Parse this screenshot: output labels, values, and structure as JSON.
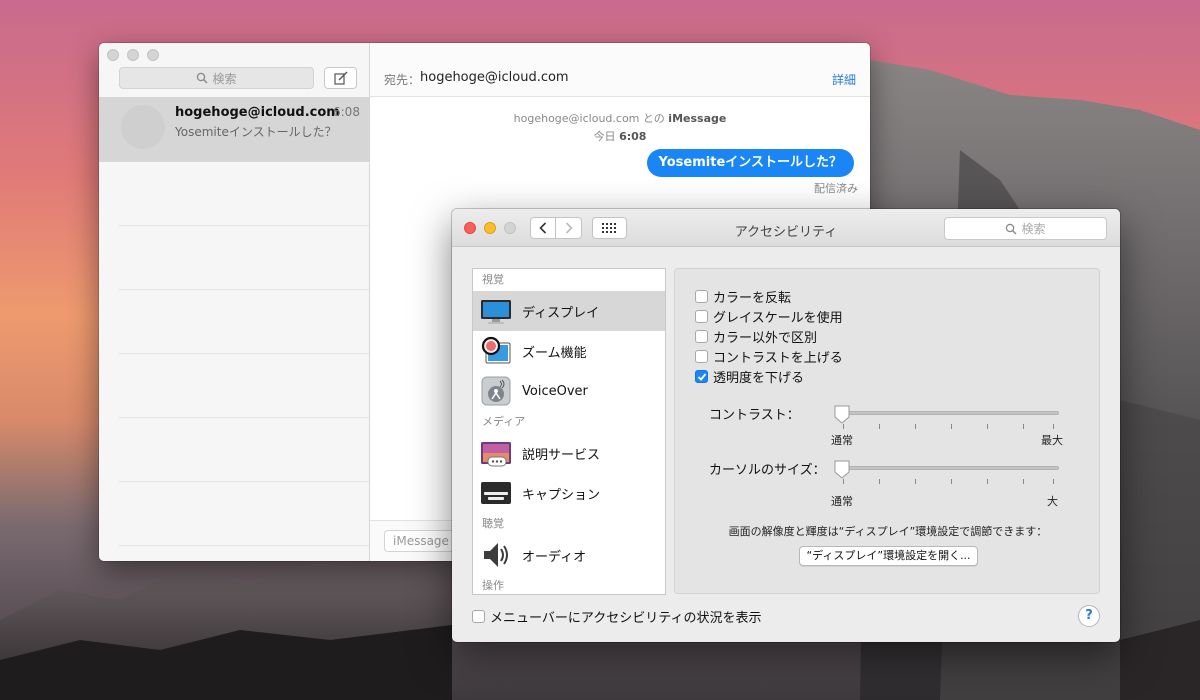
{
  "messages": {
    "search_placeholder": "検索",
    "conversation": {
      "name": "hogehoge@icloud.com",
      "time": "6:08",
      "preview": "Yosemiteインストールした？"
    },
    "header": {
      "to_prefix": "宛先：",
      "to_address": "hogehoge@icloud.com",
      "details": "詳細"
    },
    "thread_info": {
      "address": "hogehoge@icloud.com",
      "with": "との",
      "service": "iMessage",
      "day": "今日",
      "time": "6:08"
    },
    "bubble_text": "Yosemiteインストールした？",
    "delivered": "配信済み",
    "input_placeholder": "iMessage"
  },
  "accessibility": {
    "title": "アクセシビリティ",
    "search_placeholder": "検索",
    "sections": {
      "vision": "視覚",
      "media": "メディア",
      "hearing": "聴覚",
      "interaction": "操作"
    },
    "items": {
      "display": "ディスプレイ",
      "zoom": "ズーム機能",
      "voiceover": "VoiceOver",
      "descriptions": "説明サービス",
      "captions": "キャプション",
      "audio": "オーディオ"
    },
    "checkboxes": [
      {
        "label": "カラーを反転",
        "checked": false
      },
      {
        "label": "グレイスケールを使用",
        "checked": false
      },
      {
        "label": "カラー以外で区別",
        "checked": false
      },
      {
        "label": "コントラストを上げる",
        "checked": false
      },
      {
        "label": "透明度を下げる",
        "checked": true
      }
    ],
    "contrast": {
      "label": "コントラスト：",
      "min": "通常",
      "max": "最大",
      "value": 0
    },
    "cursor": {
      "label": "カーソルのサイズ：",
      "min": "通常",
      "max": "大",
      "value": 0
    },
    "display_note": "画面の解像度と輝度は“ディスプレイ”環境設定で調節できます：",
    "open_display_button": "“ディスプレイ”環境設定を開く...",
    "menubar_checkbox": "メニューバーにアクセシビリティの状況を表示",
    "help": "?",
    "accent_color": "#1a86f5"
  }
}
